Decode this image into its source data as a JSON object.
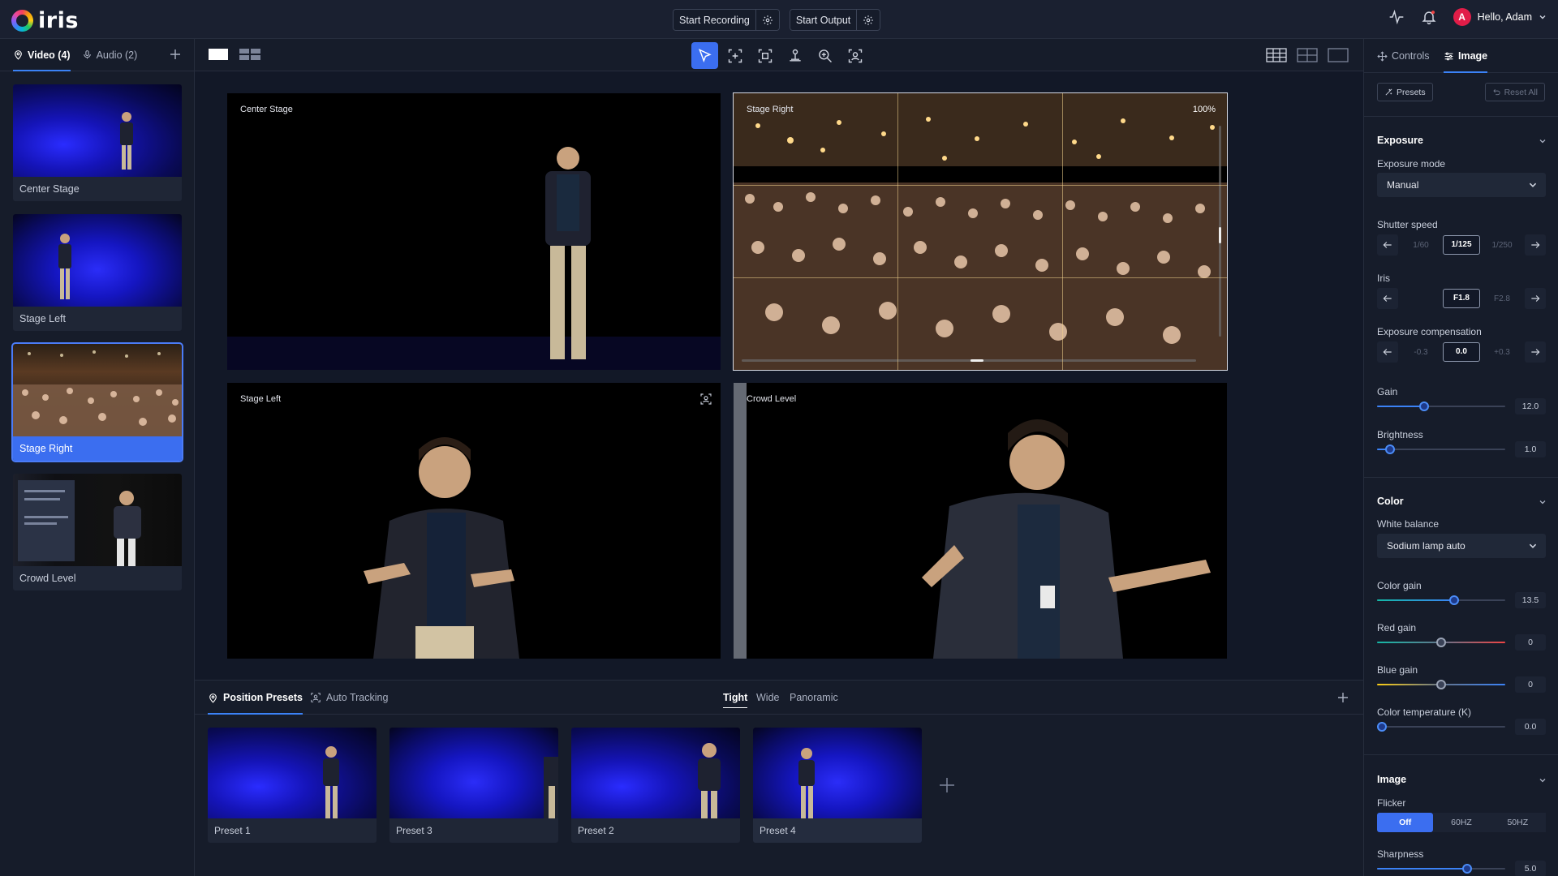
{
  "app": {
    "name": "iris"
  },
  "topbar": {
    "start_recording": "Start Recording",
    "start_output": "Start Output",
    "greeting": "Hello, Adam",
    "avatar_initial": "A"
  },
  "sources": {
    "tabs": [
      {
        "label": "Video (4)",
        "active": true
      },
      {
        "label": "Audio (2)",
        "active": false
      }
    ],
    "cameras": [
      {
        "label": "Center Stage",
        "active": false
      },
      {
        "label": "Stage Left",
        "active": false
      },
      {
        "label": "Stage Right",
        "active": true
      },
      {
        "label": "Crowd Level",
        "active": false
      }
    ]
  },
  "monitors": [
    {
      "label": "Center Stage"
    },
    {
      "label": "Stage Right",
      "zoom": "100%"
    },
    {
      "label": "Stage Left"
    },
    {
      "label": "Crowd Level"
    }
  ],
  "presets_panel": {
    "tabs": [
      {
        "label": "Position Presets",
        "active": true
      },
      {
        "label": "Auto Tracking",
        "active": false
      }
    ],
    "zoom_tabs": [
      {
        "label": "Tight",
        "active": true
      },
      {
        "label": "Wide",
        "active": false
      },
      {
        "label": "Panoramic",
        "active": false
      }
    ],
    "presets": [
      {
        "label": "Preset 1"
      },
      {
        "label": "Preset 3"
      },
      {
        "label": "Preset 2"
      },
      {
        "label": "Preset 4"
      }
    ]
  },
  "right_panel": {
    "tabs": [
      {
        "label": "Controls",
        "active": false
      },
      {
        "label": "Image",
        "active": true
      }
    ],
    "presets_button": "Presets",
    "reset_all_button": "Reset All",
    "exposure": {
      "title": "Exposure",
      "mode_label": "Exposure mode",
      "mode_value": "Manual",
      "shutter_label": "Shutter speed",
      "shutter": {
        "prev": "1/60",
        "current": "1/125",
        "next": "1/250"
      },
      "iris_label": "Iris",
      "iris": {
        "prev": "",
        "current": "F1.8",
        "next": "F2.8"
      },
      "comp_label": "Exposure compensation",
      "comp": {
        "prev": "-0.3",
        "current": "0.0",
        "next": "+0.3"
      },
      "gain_label": "Gain",
      "gain_value": "12.0",
      "gain_fraction": 0.37,
      "brightness_label": "Brightness",
      "brightness_value": "1.0",
      "brightness_fraction": 0.1
    },
    "color": {
      "title": "Color",
      "wb_label": "White balance",
      "wb_value": "Sodium lamp auto",
      "color_gain_label": "Color gain",
      "color_gain_value": "13.5",
      "color_gain_fraction": 0.6,
      "red_gain_label": "Red gain",
      "red_gain_value": "0",
      "red_gain_fraction": 0.5,
      "blue_gain_label": "Blue gain",
      "blue_gain_value": "0",
      "blue_gain_fraction": 0.5,
      "temp_label": "Color temperature (K)",
      "temp_value": "0.0",
      "temp_fraction": 0.04
    },
    "image": {
      "title": "Image",
      "flicker_label": "Flicker",
      "flicker_options": [
        {
          "label": "Off",
          "active": true
        },
        {
          "label": "60HZ",
          "active": false
        },
        {
          "label": "50HZ",
          "active": false
        }
      ],
      "sharpness_label": "Sharpness",
      "sharpness_value": "5.0",
      "sharpness_fraction": 0.7
    }
  },
  "colors": {
    "accent": "#3b6ef0",
    "background": "#121827",
    "panel": "#161c2a",
    "stage_blue": "#1514b8",
    "red_gain_end": "#ef4444",
    "blue_gain_start": "#facc15"
  }
}
